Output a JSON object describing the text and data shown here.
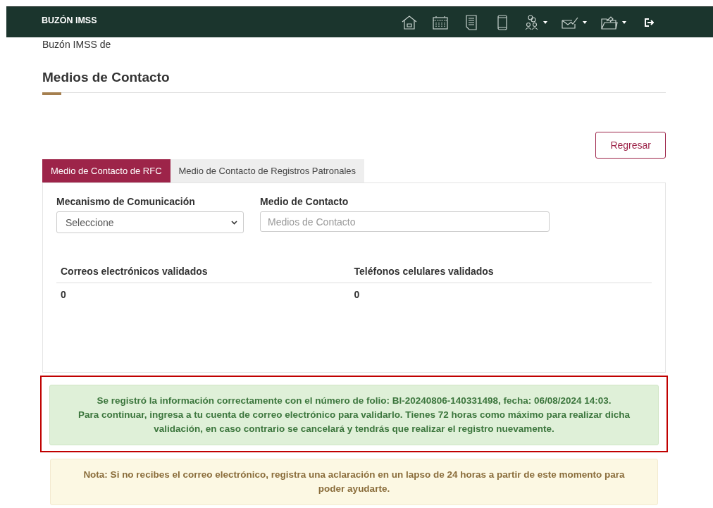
{
  "header": {
    "title": "BUZÓN IMSS",
    "icons": [
      {
        "kind": "home",
        "has_dropdown": false
      },
      {
        "kind": "calendar",
        "has_dropdown": false
      },
      {
        "kind": "document",
        "has_dropdown": false
      },
      {
        "kind": "phone",
        "has_dropdown": false
      },
      {
        "kind": "people",
        "has_dropdown": true
      },
      {
        "kind": "envelope",
        "has_dropdown": true
      },
      {
        "kind": "folder",
        "has_dropdown": true
      },
      {
        "kind": "logout",
        "has_dropdown": false
      }
    ]
  },
  "subtitle": "Buzón IMSS de",
  "page_title": "Medios de Contacto",
  "back_button": "Regresar",
  "tabs": [
    {
      "label": "Medio de Contacto de RFC",
      "selected": true
    },
    {
      "label": "Medio de Contacto de Registros Patronales",
      "selected": false
    }
  ],
  "form": {
    "mechanism": {
      "label": "Mecanismo de Comunicación",
      "value": "Seleccione"
    },
    "contact": {
      "label": "Medio de Contacto",
      "placeholder": "Medios de Contacto"
    }
  },
  "table": {
    "columns": [
      "Correos electrónicos validados",
      "Teléfonos celulares validados"
    ],
    "rows": [
      [
        "0",
        "0"
      ]
    ]
  },
  "success_alert": {
    "highlighted": true,
    "lines": [
      "Se registró la información correctamente con el número de folio: BI-20240806-140331498, fecha: 06/08/2024 14:03.",
      "Para continuar, ingresa a tu cuenta de correo electrónico para validarlo. Tienes 72 horas como máximo para realizar dicha validación, en caso contrario se cancelará y tendrás que realizar el registro nuevamente."
    ]
  },
  "note_alert": "Nota: Si no recibes el correo electrónico, registra una aclaración en un lapso de 24 horas a partir de este momento para poder ayudarte."
}
